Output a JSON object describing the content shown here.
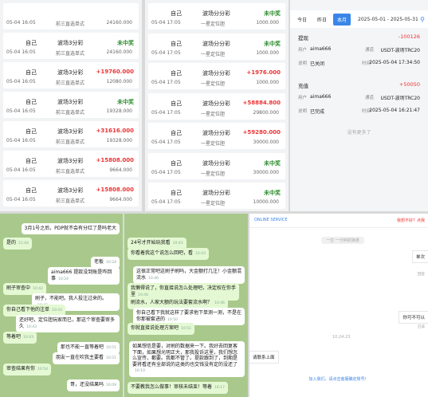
{
  "panel1": {
    "rows": [
      {
        "date": "05-04 16:05",
        "user": "",
        "game": "",
        "play": "前三直选单式",
        "amount": "24160.000",
        "amount_class": "muted"
      },
      {
        "date": "05-04 16:05",
        "user": "自己",
        "game": "波场3分彩",
        "play": "前三直选单式",
        "amount": "24160.000",
        "result": "未中奖",
        "result_class": "lose"
      },
      {
        "date": "05-04 16:05",
        "user": "自己",
        "game": "波场3分彩",
        "play": "前三直选单式",
        "amount": "12080.000",
        "result": "+19760.000",
        "result_class": "win"
      },
      {
        "date": "05-04 16:05",
        "user": "自己",
        "game": "波场3分彩",
        "play": "前三直选单式",
        "amount": "19328.000",
        "result": "未中奖",
        "result_class": "lose"
      },
      {
        "date": "05-04 16:05",
        "user": "自己",
        "game": "波场3分彩",
        "play": "前三直选单式",
        "amount": "19328.000",
        "result": "+31616.000",
        "result_class": "win"
      },
      {
        "date": "05-04 16:05",
        "user": "自己",
        "game": "波场3分彩",
        "play": "前三直选单式",
        "amount": "9664.000",
        "result": "+15808.000",
        "result_class": "win"
      },
      {
        "date": "05-04 16:05",
        "user": "自己",
        "game": "波场3分彩",
        "play": "前三直选单式",
        "amount": "9664.000",
        "result": "+15808.000",
        "result_class": "win"
      }
    ]
  },
  "panel2": {
    "rows": [
      {
        "date": "05-04 17:05",
        "user": "自己",
        "game": "波场分分彩",
        "play": "一星定位胆",
        "amount": "1000.000",
        "result": "未中奖",
        "result_class": "lose"
      },
      {
        "date": "05-04 17:05",
        "user": "自己",
        "game": "波场分分彩",
        "play": "一星定位胆",
        "amount": "1000.000",
        "result": "未中奖",
        "result_class": "lose"
      },
      {
        "date": "05-04 17:05",
        "user": "自己",
        "game": "波场分分彩",
        "play": "一星定位胆",
        "amount": "1000.000",
        "result": "+1976.000",
        "result_class": "win"
      },
      {
        "date": "05-04 17:05",
        "user": "自己",
        "game": "波场分分彩",
        "play": "一星定位胆",
        "amount": "29800.000",
        "result": "+58884.800",
        "result_class": "win"
      },
      {
        "date": "05-04 17:05",
        "user": "自己",
        "game": "波场分分彩",
        "play": "一星定位胆",
        "amount": "30000.000",
        "result": "+59280.000",
        "result_class": "win"
      },
      {
        "date": "05-04 17:05",
        "user": "自己",
        "game": "波场分分彩",
        "play": "一星定位胆",
        "amount": "30000.000",
        "result": "未中奖",
        "result_class": "lose"
      },
      {
        "date": "05-04 17:05",
        "user": "自己",
        "game": "波场分分彩",
        "play": "一星定位胆",
        "amount": "10000.000",
        "result": "未中奖",
        "result_class": "lose"
      }
    ]
  },
  "panel3": {
    "tabs": [
      "今日",
      "昨日",
      "本月"
    ],
    "active_tab": "本月",
    "date_range": "2025-05-01 - 2025-05-31",
    "records": [
      {
        "type": "提现",
        "amount": "-100126",
        "user_label": "用户",
        "user": "aima666",
        "channel_label": "通道",
        "channel": "USDT-波场TRC20",
        "note_label": "说明",
        "note": "已关闭",
        "time_label": "时间",
        "time": "2025-05-04 17:34:50"
      },
      {
        "type": "充值",
        "amount": "+50050",
        "user_label": "用户",
        "user": "aima666",
        "channel_label": "通道",
        "channel": "USDT-波场TRC20",
        "note_label": "说明",
        "note": "已完成",
        "time_label": "时间",
        "time": "2025-05-04 16:21:47"
      }
    ],
    "no_more": "没有更多了"
  },
  "panel4": {
    "messages": [
      {
        "dir": "in",
        "text": "3月1号之后，PDP就不会有分红了是吗老大",
        "time": ""
      },
      {
        "dir": "out",
        "text": "是的",
        "time": "21:04"
      },
      {
        "dir": "in",
        "text": "老板",
        "time": "10:24"
      },
      {
        "dir": "in",
        "text": "aima666 提款没到账是咋回事",
        "time": "10:24"
      },
      {
        "dir": "out",
        "text": "刷子审查中",
        "time": "10:42"
      },
      {
        "dir": "in",
        "text": "刷子，不能吧。我人投注过来的。",
        "time": "10:42"
      },
      {
        "dir": "out",
        "text": "你自己看下他的注单",
        "time": "10:43"
      },
      {
        "dir": "in",
        "text": "还好吧，定位胆玩家而已，那这个审查要审多久",
        "time": "10:43"
      },
      {
        "dir": "out",
        "text": "等着吧",
        "time": "10:43"
      },
      {
        "dir": "in",
        "text": "那也不能一直等着吧",
        "time": "10:51"
      },
      {
        "dir": "in",
        "text": "朋友一直在吹我主要看",
        "time": "10:51"
      },
      {
        "dir": "out",
        "text": "审查结果有你",
        "time": "10:54"
      },
      {
        "dir": "in",
        "text": "哥，还没结果吗",
        "time": "16:09"
      }
    ]
  },
  "panel5": {
    "messages": [
      {
        "dir": "out",
        "text": "24号才开始玩我看",
        "time": "10:43"
      },
      {
        "dir": "out",
        "text": "你看着我这个说怎么回吧，看",
        "time": "10:43"
      },
      {
        "dir": "in",
        "text": "这很正常吧这刷子刷吗，大金额打几注！小金额混流水",
        "time": "10:46"
      },
      {
        "dir": "out",
        "text": "我懒得说了，你直接说怎么处理吧，决定权在你手里",
        "time": "10:46"
      },
      {
        "dir": "out",
        "text": "刷流水，人家大额的玩法要套流水啊？",
        "time": "10:46"
      },
      {
        "dir": "in",
        "text": "你自己看下我就这样了要求他下单测一测，不是在你那被套进的",
        "time": "10:50"
      },
      {
        "dir": "out",
        "text": "你就直接说处理方案吧",
        "time": "10:51"
      },
      {
        "dir": "in",
        "text": "如果想信是要，对刷的数据来一下。我好去回复客下面，如果想光明正大，那我投诉这里，我们想怎么宣传，都要。我都不管了。提款跟到了，到期是要将看还有全部说的这类的也交钱没有定的没还了",
        "time": "16:10"
      },
      {
        "dir": "out",
        "text": "不要教我怎么做事！审核未结束！等着",
        "time": "16:17"
      }
    ]
  },
  "panel6": {
    "header_title": "ONLINE SERVICE",
    "header_right": "我想不好？点我",
    "system_notice": "一位 一分钟前接通",
    "side_notes": [
      "单次",
      "回答",
      "你可不可以",
      "已读"
    ],
    "msg_left": "请联系上面",
    "timestamp": "10:24:23",
    "footer": "加入我们，请点击客服确定账号！"
  }
}
